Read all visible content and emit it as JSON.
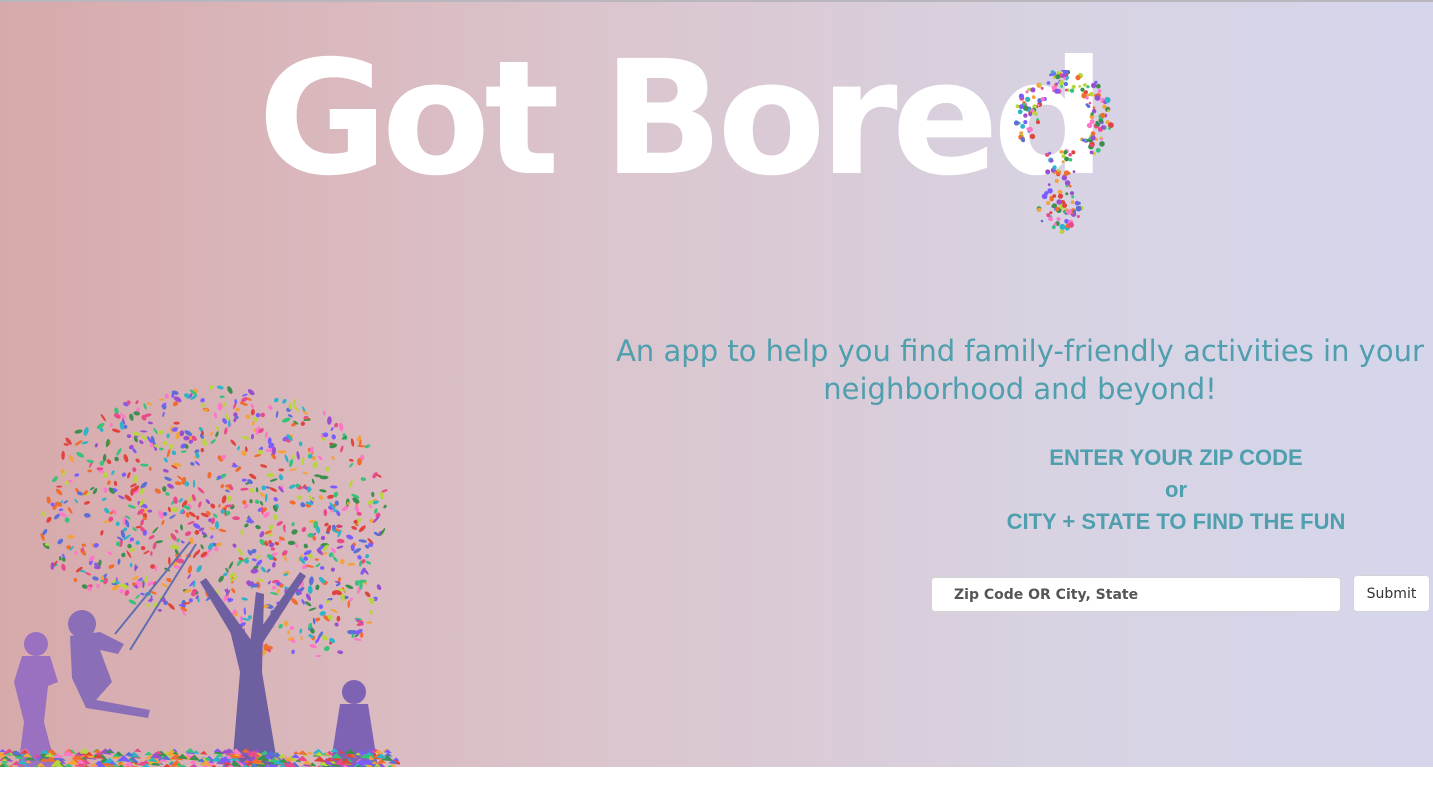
{
  "header": {
    "title": "Got Bored"
  },
  "hero": {
    "tagline": "An app to help you find family-friendly activities in your neighborhood and beyond!",
    "prompt": {
      "line1": "ENTER YOUR ZIP CODE",
      "line2": "or",
      "line3": "CITY + STATE TO FIND THE FUN"
    }
  },
  "search": {
    "placeholder": "Zip Code OR City, State",
    "value": "",
    "submit_label": "Submit"
  },
  "icons": {
    "question_mark": "mosaic-question-mark-icon",
    "illustration": "mosaic-tree-with-children-swinging"
  },
  "colors": {
    "gradient_left": "#d7a9aa",
    "gradient_right": "#d5d6ec",
    "title": "#ffffff",
    "accent_text": "#4f9fae"
  }
}
